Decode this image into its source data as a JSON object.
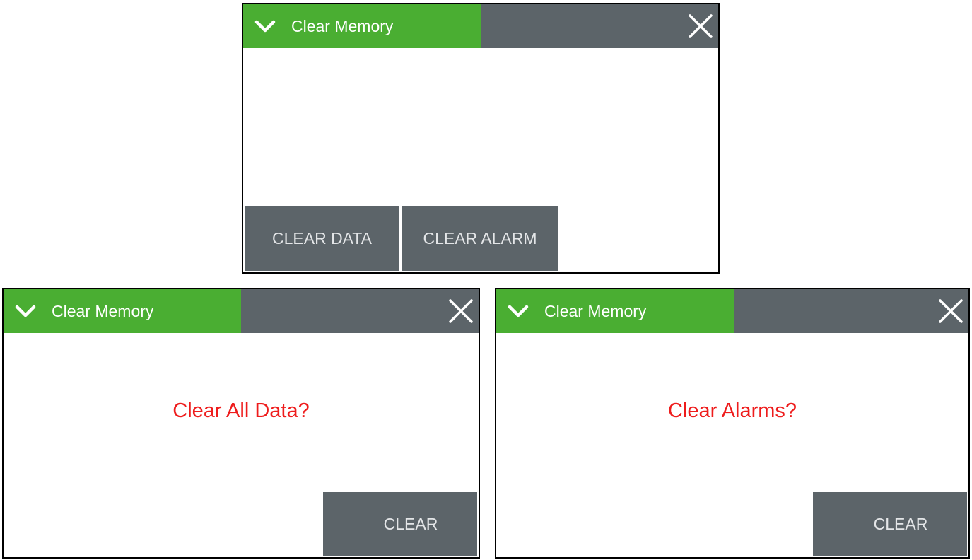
{
  "colors": {
    "title_green": "#4aae32",
    "title_gray": "#5c6469",
    "button_gray": "#5c6469",
    "button_text": "#e4e6e8",
    "prompt_red": "#ee1c1c"
  },
  "icons": {
    "collapse": "chevron-down-icon",
    "close": "close-icon"
  },
  "screens": {
    "menu": {
      "title": "Clear Memory",
      "buttons": {
        "clear_data": "CLEAR DATA",
        "clear_alarm": "CLEAR ALARM"
      }
    },
    "clear_data_confirm": {
      "title": "Clear Memory",
      "prompt": "Clear All Data?",
      "button": "CLEAR"
    },
    "clear_alarms_confirm": {
      "title": "Clear Memory",
      "prompt": "Clear Alarms?",
      "button": "CLEAR"
    }
  }
}
